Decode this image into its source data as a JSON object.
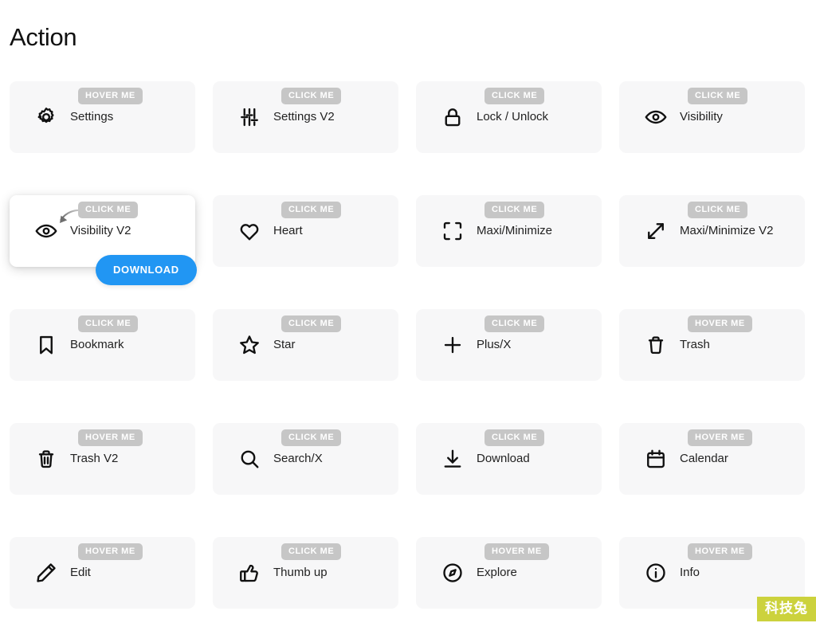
{
  "header": {
    "title": "Action"
  },
  "colors": {
    "page_background": "#ffffff",
    "card_background": "#f7f7f8",
    "card_active_background": "#ffffff",
    "badge_background": "#c6c6c6",
    "badge_text": "#ffffff",
    "icon": "#111111",
    "label_text": "#222222",
    "download_button": "#2196f3",
    "watermark_background": "#ccd23d"
  },
  "badges": {
    "hover": "HOVER ME",
    "click": "CLICK ME"
  },
  "overlay": {
    "download_label": "DOWNLOAD",
    "cursor_icon": "curved-arrow-icon"
  },
  "watermark": {
    "text": "科技兔"
  },
  "grid": {
    "columns": 4,
    "cards": [
      {
        "label": "Settings",
        "badge": "HOVER ME",
        "icon": "gear-icon",
        "active": false
      },
      {
        "label": "Settings V2",
        "badge": "CLICK ME",
        "icon": "sliders-icon",
        "active": false
      },
      {
        "label": "Lock / Unlock",
        "badge": "CLICK ME",
        "icon": "lock-icon",
        "active": false
      },
      {
        "label": "Visibility",
        "badge": "CLICK ME",
        "icon": "eye-icon",
        "active": false
      },
      {
        "label": "Visibility V2",
        "badge": "CLICK ME",
        "icon": "eye-icon",
        "active": true
      },
      {
        "label": "Heart",
        "badge": "CLICK ME",
        "icon": "heart-icon",
        "active": false
      },
      {
        "label": "Maxi/Minimize",
        "badge": "CLICK ME",
        "icon": "fullscreen-icon",
        "active": false
      },
      {
        "label": "Maxi/Minimize V2",
        "badge": "CLICK ME",
        "icon": "expand-arrows-icon",
        "active": false
      },
      {
        "label": "Bookmark",
        "badge": "CLICK ME",
        "icon": "bookmark-icon",
        "active": false
      },
      {
        "label": "Star",
        "badge": "CLICK ME",
        "icon": "star-icon",
        "active": false
      },
      {
        "label": "Plus/X",
        "badge": "CLICK ME",
        "icon": "plus-icon",
        "active": false
      },
      {
        "label": "Trash",
        "badge": "HOVER ME",
        "icon": "trash-icon",
        "active": false
      },
      {
        "label": "Trash V2",
        "badge": "HOVER ME",
        "icon": "trash-lines-icon",
        "active": false
      },
      {
        "label": "Search/X",
        "badge": "CLICK ME",
        "icon": "search-icon",
        "active": false
      },
      {
        "label": "Download",
        "badge": "CLICK ME",
        "icon": "download-icon",
        "active": false
      },
      {
        "label": "Calendar",
        "badge": "HOVER ME",
        "icon": "calendar-icon",
        "active": false
      },
      {
        "label": "Edit",
        "badge": "HOVER ME",
        "icon": "pencil-icon",
        "active": false
      },
      {
        "label": "Thumb up",
        "badge": "CLICK ME",
        "icon": "thumb-up-icon",
        "active": false
      },
      {
        "label": "Explore",
        "badge": "HOVER ME",
        "icon": "compass-icon",
        "active": false
      },
      {
        "label": "Info",
        "badge": "HOVER ME",
        "icon": "info-icon",
        "active": false
      }
    ]
  }
}
